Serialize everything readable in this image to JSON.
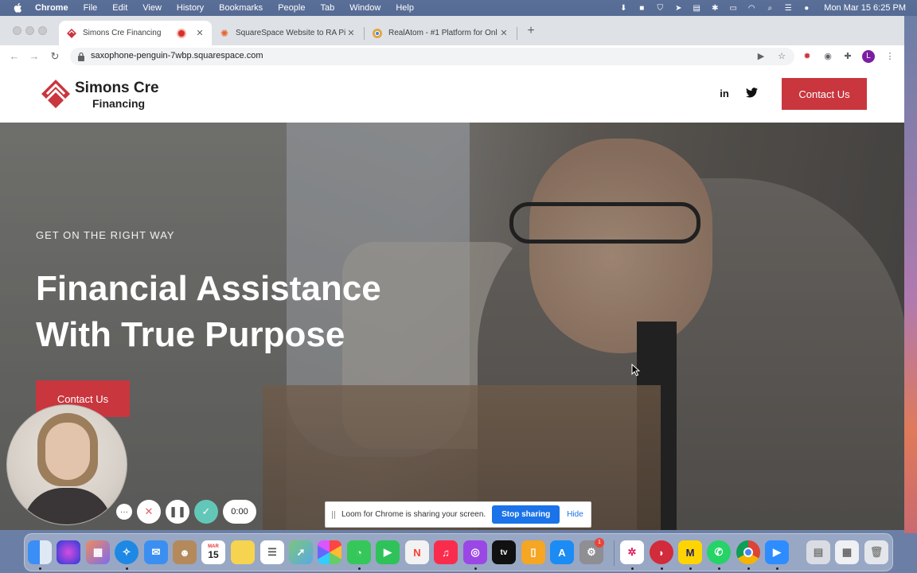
{
  "menubar": {
    "app": "Chrome",
    "items": [
      "File",
      "Edit",
      "View",
      "History",
      "Bookmarks",
      "People",
      "Tab",
      "Window",
      "Help"
    ],
    "clock": "Mon Mar 15  6:25 PM"
  },
  "browser": {
    "tabs": [
      {
        "title": "Simons Cre Financing",
        "active": true
      },
      {
        "title": "SquareSpace Website to RA Pi",
        "active": false
      },
      {
        "title": "RealAtom - #1 Platform for Onl",
        "active": false
      }
    ],
    "new_tab": "+",
    "url": "saxophone-penguin-7wbp.squarespace.com",
    "profile_initial": "L"
  },
  "site": {
    "logo_line1": "Simons Cre",
    "logo_line2": "Financing",
    "linkedin": "in",
    "header_cta": "Contact Us",
    "hero_kicker": "GET ON THE RIGHT WAY",
    "hero_title_line1": "Financial Assistance",
    "hero_title_line2": "With True Purpose",
    "hero_cta": "Contact Us"
  },
  "loom": {
    "timer": "0:00",
    "more": "···",
    "share_message": "Loom for Chrome is sharing your screen.",
    "stop_sharing": "Stop sharing",
    "hide": "Hide"
  },
  "dock": {
    "calendar_month": "MAR",
    "calendar_day": "15",
    "badge": "1"
  },
  "colors": {
    "brand_red": "#c9363e",
    "loom_blue": "#1a73e8",
    "loom_green": "#63c7b8"
  }
}
